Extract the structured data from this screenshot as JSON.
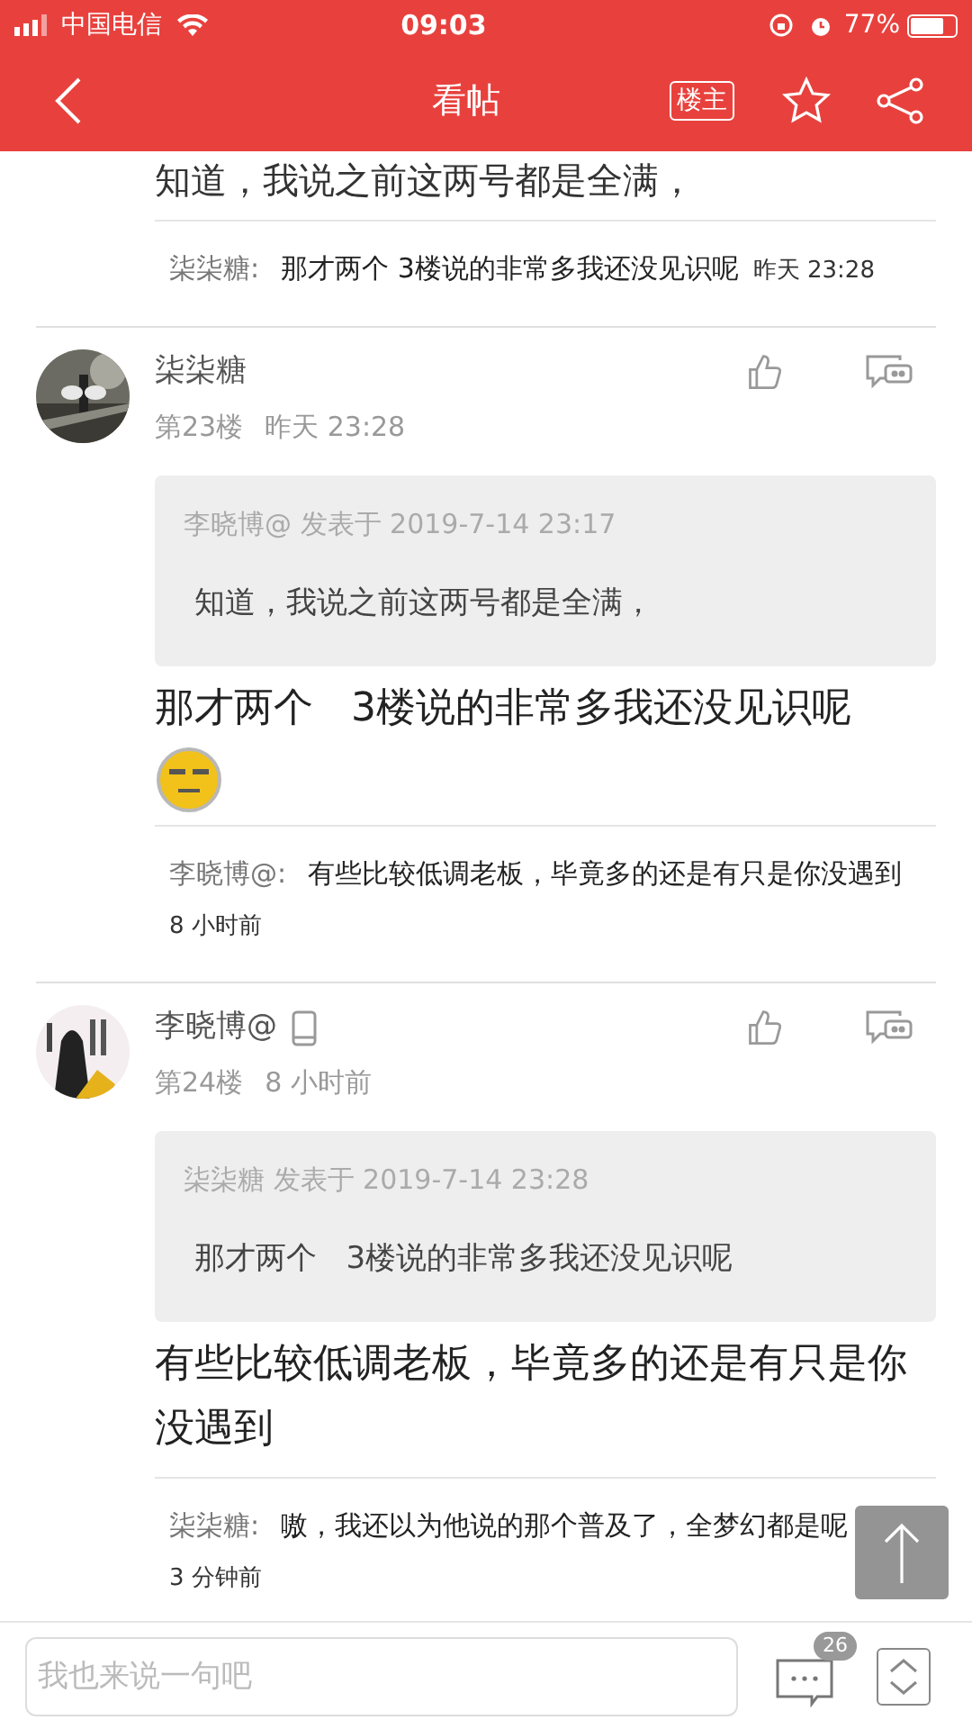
{
  "status_bar": {
    "carrier": "中国电信",
    "time": "09:03",
    "battery": "77%"
  },
  "header": {
    "title": "看帖",
    "owner_badge": "楼主"
  },
  "posts": [
    {
      "kind": "partial",
      "body": "知道，我说之前这两号都是全满，",
      "replies": [
        {
          "author": "柒柒糖:",
          "text": "那才两个 3楼说的非常多我还没见识呢",
          "time": "昨天 23:28"
        }
      ]
    },
    {
      "kind": "full",
      "author": "柒柒糖",
      "device": false,
      "floor": "第23楼",
      "time": "昨天 23:28",
      "quote": {
        "byline": "李晓博@ 发表于 2019-7-14 23:17",
        "text": "知道，我说之前这两号都是全满，"
      },
      "body": "那才两个   3楼说的非常多我还没见识呢",
      "emoji": true,
      "replies": [
        {
          "author": "李晓博@:",
          "text": "有些比较低调老板，毕竟多的还是有只是你没遇到",
          "time": "8 小时前"
        }
      ]
    },
    {
      "kind": "full",
      "author": "李晓博@",
      "device": true,
      "floor": "第24楼",
      "time": "8 小时前",
      "quote": {
        "byline": "柒柒糖 发表于 2019-7-14 23:28",
        "text": "那才两个   3楼说的非常多我还没见识呢"
      },
      "body": "有些比较低调老板，毕竟多的还是有只是你没遇到",
      "emoji": false,
      "replies": [
        {
          "author": "柒柒糖:",
          "text": "嗷，我还以为他说的那个普及了，全梦幻都是呢",
          "time": "3 分钟前"
        }
      ]
    }
  ],
  "composer": {
    "placeholder": "我也来说一句吧",
    "comment_count": "26"
  }
}
